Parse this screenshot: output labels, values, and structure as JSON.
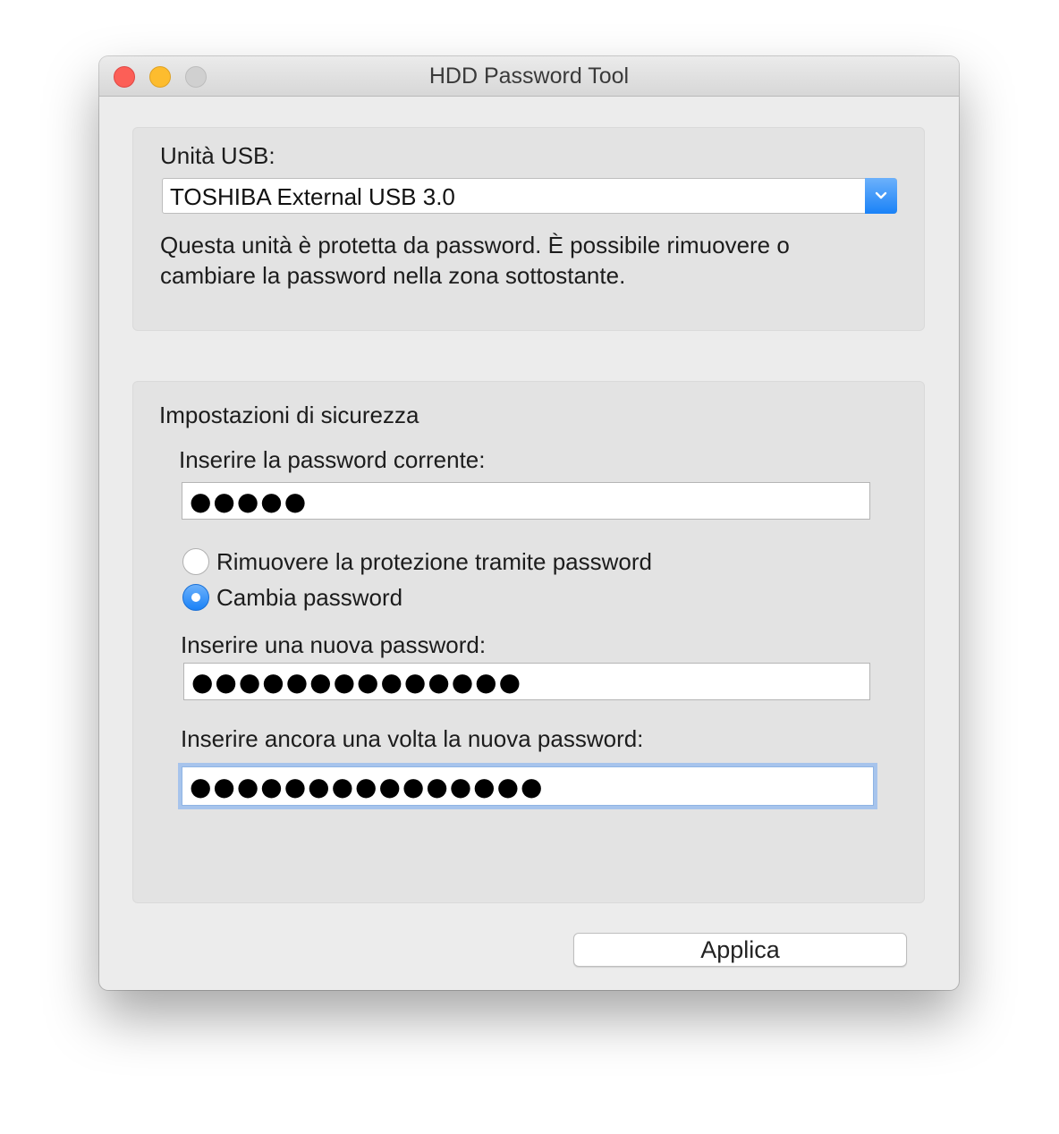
{
  "window": {
    "title": "HDD Password Tool"
  },
  "usb": {
    "label": "Unità USB:",
    "selected": "TOSHIBA External USB 3.0",
    "description": "Questa unità è protetta da password. È possibile rimuovere o cambiare la password nella zona sottostante."
  },
  "security": {
    "title": "Impostazioni di sicurezza",
    "current_label": "Inserire la password corrente:",
    "current_value": "●●●●●",
    "options": [
      {
        "label": "Rimuovere la protezione tramite password",
        "selected": false
      },
      {
        "label": "Cambia password",
        "selected": true
      }
    ],
    "new_label": "Inserire una nuova password:",
    "new_value": "●●●●●●●●●●●●●●",
    "confirm_label": "Inserire ancora una volta la nuova password:",
    "confirm_value": "●●●●●●●●●●●●●●●"
  },
  "actions": {
    "apply_label": "Applica"
  },
  "colors": {
    "accent": "#1a82f7",
    "close": "#fc5f57",
    "minimize": "#fdbc2e",
    "maximize": "#d0d0d0",
    "focus_ring": "#a7c4ec"
  },
  "icons": {
    "close": "close-icon",
    "minimize": "minimize-icon",
    "maximize": "maximize-icon",
    "dropdown": "chevron-down-icon"
  }
}
